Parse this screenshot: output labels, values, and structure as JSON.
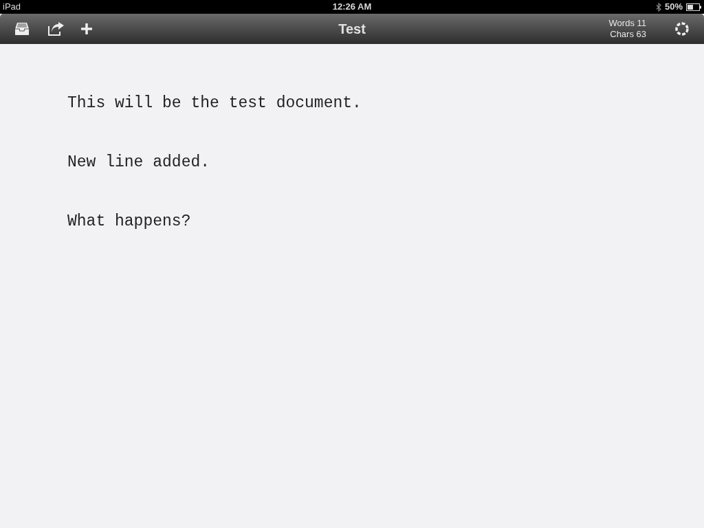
{
  "status_bar": {
    "device": "iPad",
    "time": "12:26 AM",
    "battery": "50%"
  },
  "toolbar": {
    "title": "Test",
    "words_label": "Words",
    "words": "11",
    "chars_label": "Chars",
    "chars": "63"
  },
  "document": {
    "lines": [
      "This will be the test document.",
      "New line added.",
      "What happens?"
    ]
  }
}
